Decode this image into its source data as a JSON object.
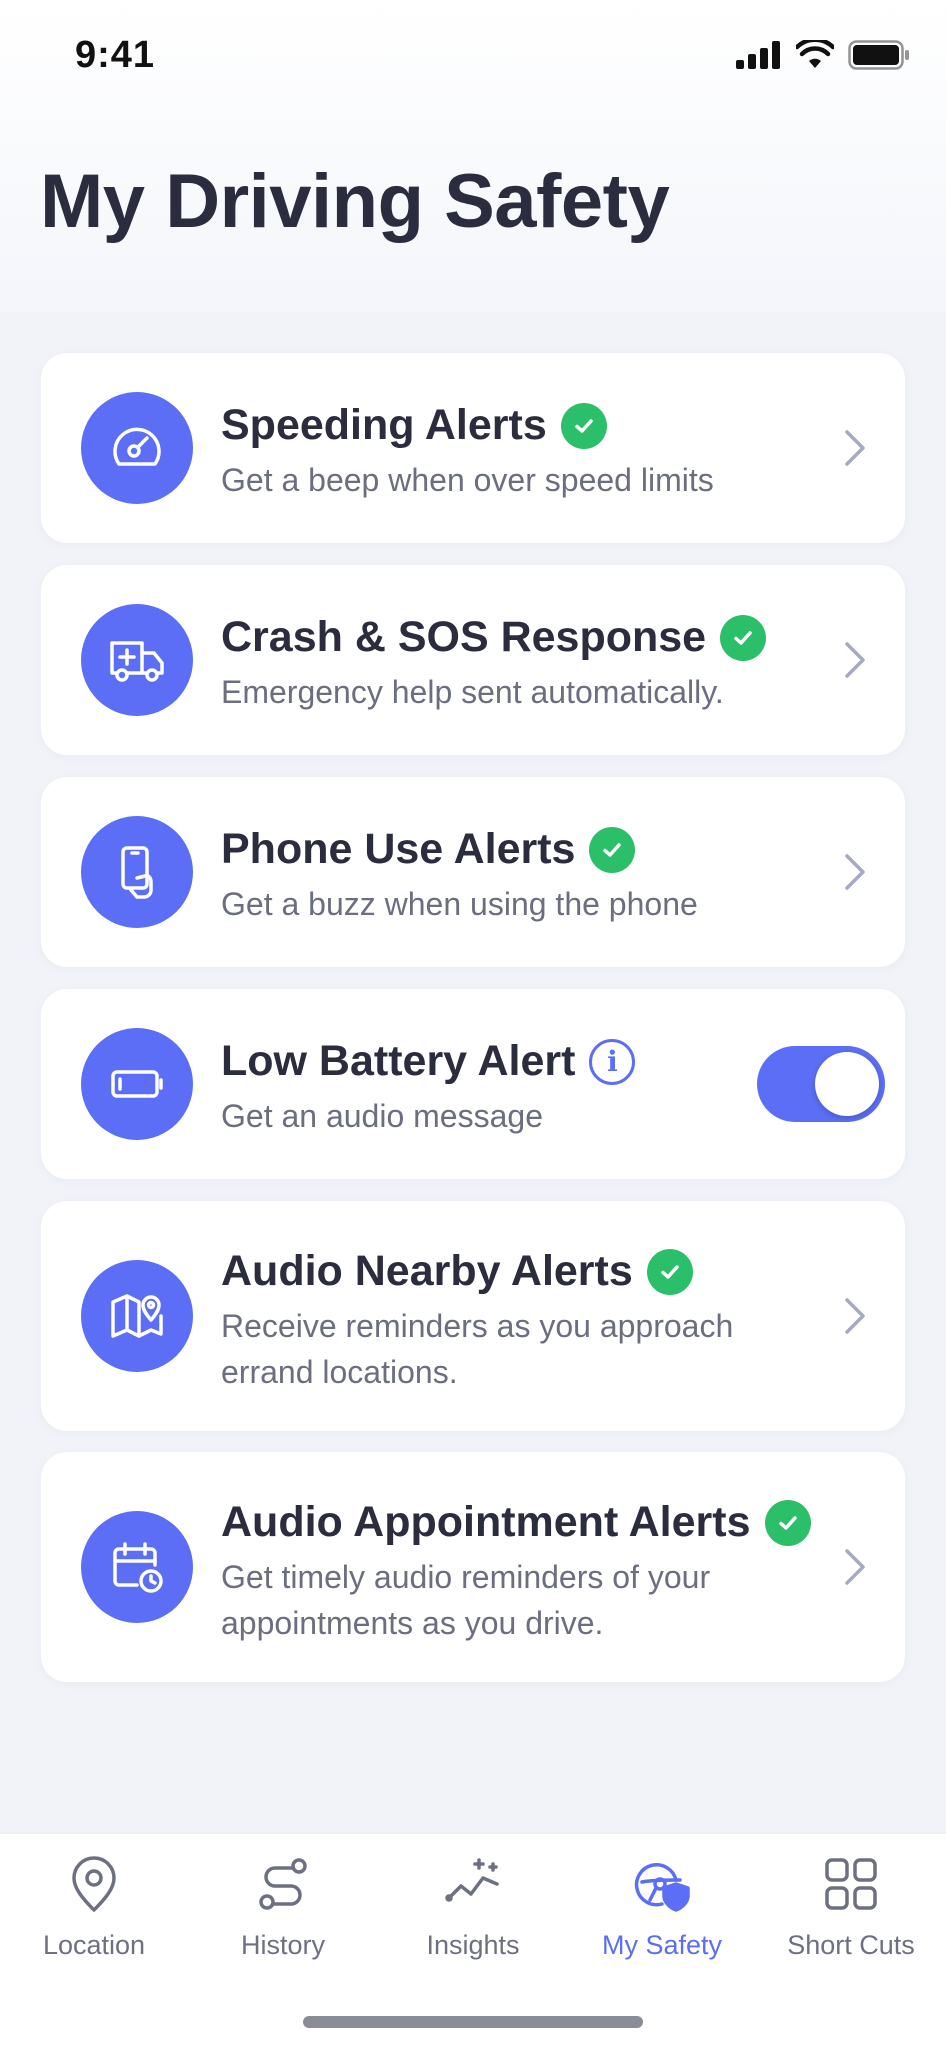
{
  "status": {
    "time": "9:41"
  },
  "page": {
    "title": "My Driving Safety"
  },
  "colors": {
    "accent": "#5b6ef5",
    "success": "#2bbf6a"
  },
  "cards": [
    {
      "title": "Speeding Alerts",
      "subtitle": "Get a beep when over speed limits",
      "icon": "speedometer-icon",
      "status": "enabled-check"
    },
    {
      "title": "Crash & SOS Response",
      "subtitle": "Emergency help sent automatically.",
      "icon": "ambulance-icon",
      "status": "enabled-check"
    },
    {
      "title": "Phone Use Alerts",
      "subtitle": "Get a buzz when using the phone",
      "icon": "phone-hand-icon",
      "status": "enabled-check"
    },
    {
      "title": "Low Battery Alert",
      "subtitle": "Get an audio message",
      "icon": "battery-icon",
      "status": "info",
      "toggle_on": true
    },
    {
      "title": "Audio Nearby Alerts",
      "subtitle": "Receive reminders as you approach errand locations.",
      "icon": "map-pin-icon",
      "status": "enabled-check"
    },
    {
      "title": "Audio Appointment Alerts",
      "subtitle": "Get timely audio reminders of your appointments as you drive.",
      "icon": "calendar-clock-icon",
      "status": "enabled-check"
    }
  ],
  "tabs": [
    {
      "label": "Location",
      "icon": "location-pin-icon",
      "active": false
    },
    {
      "label": "History",
      "icon": "route-icon",
      "active": false
    },
    {
      "label": "Insights",
      "icon": "insights-chart-icon",
      "active": false
    },
    {
      "label": "My Safety",
      "icon": "steering-shield-icon",
      "active": true
    },
    {
      "label": "Short Cuts",
      "icon": "grid-icon",
      "active": false
    }
  ]
}
